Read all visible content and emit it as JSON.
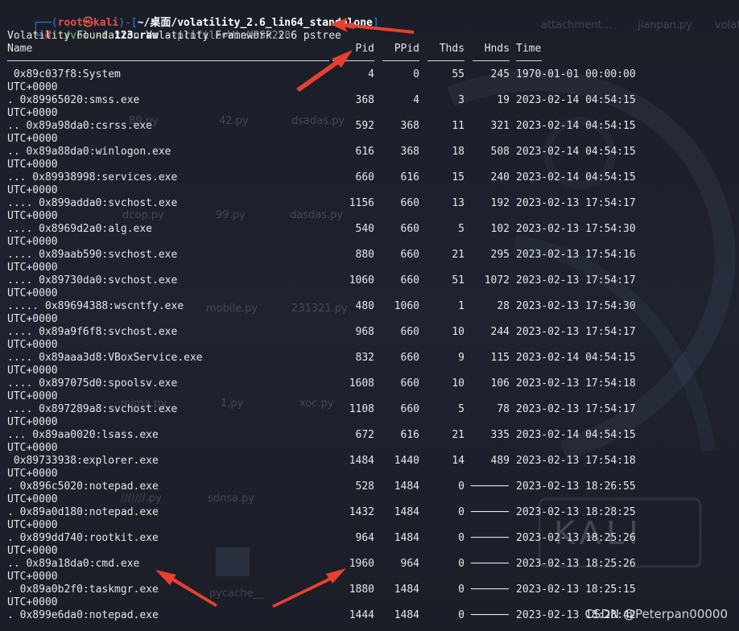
{
  "prompt": {
    "frame_top": "┌──(",
    "user_host": "root㉿kali",
    "frame_mid": ")-[",
    "path": "~/桌面/volatility_2.6_lin64_standalone",
    "frame_end": "]",
    "frame_bottom": "└─",
    "hash": "#",
    "cmd_exe": "./vol",
    "cmd_f": "-f",
    "cmd_file": "123.raw",
    "cmd_profile": "--profile=WinXPSP2x86",
    "cmd_plugin": "pstree"
  },
  "banner": "Volatility Foundation Volatility Framework 2.6",
  "headers": {
    "name": "Name",
    "pid": "Pid",
    "ppid": "PPid",
    "thds": "Thds",
    "hnds": "Hnds",
    "time": "Time"
  },
  "rows": [
    {
      "name": " 0x89c037f8:System",
      "pid": "4",
      "ppid": "0",
      "thds": "55",
      "hnds": "245",
      "time": "1970-01-01 00:00:00",
      "tz": "UTC+0000"
    },
    {
      "name": ". 0x89965020:smss.exe",
      "pid": "368",
      "ppid": "4",
      "thds": "3",
      "hnds": "19",
      "time": "2023-02-14 04:54:15",
      "tz": "UTC+0000"
    },
    {
      "name": ".. 0x89a98da0:csrss.exe",
      "pid": "592",
      "ppid": "368",
      "thds": "11",
      "hnds": "321",
      "time": "2023-02-14 04:54:15",
      "tz": "UTC+0000"
    },
    {
      "name": ".. 0x89a88da0:winlogon.exe",
      "pid": "616",
      "ppid": "368",
      "thds": "18",
      "hnds": "508",
      "time": "2023-02-14 04:54:15",
      "tz": "UTC+0000"
    },
    {
      "name": "... 0x89938998:services.exe",
      "pid": "660",
      "ppid": "616",
      "thds": "15",
      "hnds": "240",
      "time": "2023-02-14 04:54:15",
      "tz": "UTC+0000"
    },
    {
      "name": ".... 0x899adda0:svchost.exe",
      "pid": "1156",
      "ppid": "660",
      "thds": "13",
      "hnds": "192",
      "time": "2023-02-13 17:54:17",
      "tz": "UTC+0000"
    },
    {
      "name": ".... 0x8969d2a0:alg.exe",
      "pid": "540",
      "ppid": "660",
      "thds": "5",
      "hnds": "102",
      "time": "2023-02-13 17:54:30",
      "tz": "UTC+0000"
    },
    {
      "name": ".... 0x89aab590:svchost.exe",
      "pid": "880",
      "ppid": "660",
      "thds": "21",
      "hnds": "295",
      "time": "2023-02-13 17:54:16",
      "tz": "UTC+0000"
    },
    {
      "name": ".... 0x89730da0:svchost.exe",
      "pid": "1060",
      "ppid": "660",
      "thds": "51",
      "hnds": "1072",
      "time": "2023-02-13 17:54:17",
      "tz": "UTC+0000"
    },
    {
      "name": "..... 0x89694388:wscntfy.exe",
      "pid": "480",
      "ppid": "1060",
      "thds": "1",
      "hnds": "28",
      "time": "2023-02-13 17:54:30",
      "tz": "UTC+0000"
    },
    {
      "name": ".... 0x89a9f6f8:svchost.exe",
      "pid": "968",
      "ppid": "660",
      "thds": "10",
      "hnds": "244",
      "time": "2023-02-13 17:54:17",
      "tz": "UTC+0000"
    },
    {
      "name": ".... 0x89aaa3d8:VBoxService.exe",
      "pid": "832",
      "ppid": "660",
      "thds": "9",
      "hnds": "115",
      "time": "2023-02-14 04:54:15",
      "tz": "UTC+0000"
    },
    {
      "name": ".... 0x897075d0:spoolsv.exe",
      "pid": "1608",
      "ppid": "660",
      "thds": "10",
      "hnds": "106",
      "time": "2023-02-13 17:54:18",
      "tz": "UTC+0000"
    },
    {
      "name": ".... 0x897289a8:svchost.exe",
      "pid": "1108",
      "ppid": "660",
      "thds": "5",
      "hnds": "78",
      "time": "2023-02-13 17:54:17",
      "tz": "UTC+0000"
    },
    {
      "name": "... 0x89aa0020:lsass.exe",
      "pid": "672",
      "ppid": "616",
      "thds": "21",
      "hnds": "335",
      "time": "2023-02-14 04:54:15",
      "tz": "UTC+0000"
    },
    {
      "name": " 0x89733938:explorer.exe",
      "pid": "1484",
      "ppid": "1440",
      "thds": "14",
      "hnds": "489",
      "time": "2023-02-13 17:54:18",
      "tz": "UTC+0000"
    },
    {
      "name": ". 0x896c5020:notepad.exe",
      "pid": "528",
      "ppid": "1484",
      "thds": "0",
      "hnds": "──────",
      "time": "2023-02-13 18:26:55",
      "tz": "UTC+0000"
    },
    {
      "name": ". 0x89a0d180:notepad.exe",
      "pid": "1432",
      "ppid": "1484",
      "thds": "0",
      "hnds": "──────",
      "time": "2023-02-13 18:28:25",
      "tz": "UTC+0000"
    },
    {
      "name": ". 0x899dd740:rootkit.exe",
      "pid": "964",
      "ppid": "1484",
      "thds": "0",
      "hnds": "──────",
      "time": "2023-02-13 18:25:26",
      "tz": "UTC+0000"
    },
    {
      "name": ".. 0x89a18da0:cmd.exe",
      "pid": "1960",
      "ppid": "964",
      "thds": "0",
      "hnds": "──────",
      "time": "2023-02-13 18:25:26",
      "tz": "UTC+0000"
    },
    {
      "name": ". 0x89a0b2f0:taskmgr.exe",
      "pid": "1880",
      "ppid": "1484",
      "thds": "0",
      "hnds": "──────",
      "time": "2023-02-13 18:25:15",
      "tz": "UTC+0000"
    },
    {
      "name": ". 0x899e6da0:notepad.exe",
      "pid": "1444",
      "ppid": "1484",
      "thds": "0",
      "hnds": "──────",
      "time": "2023-02-13 18:28:42",
      "tz": ""
    }
  ],
  "background_files": [
    "attachment...",
    "jianpan.py",
    "volati",
    "42.py",
    "89.py",
    "dsadas.py",
    "dcop.py",
    "99.py",
    "dasdas.py",
    "mobile.py",
    "231321.py",
    "mima.py",
    "1.py",
    "xoc.py",
    "///////.py",
    "sdnsa.py",
    "pycache__",
    "KALI"
  ],
  "watermark": "CSDN @Peterpan00000",
  "colors": {
    "background": "#1b1e27",
    "text": "#e6e6e6",
    "prompt_frame": "#2f7fd8",
    "prompt_root": "#e0524c",
    "command": "#6fbf5a",
    "arrow": "#e8402f"
  }
}
